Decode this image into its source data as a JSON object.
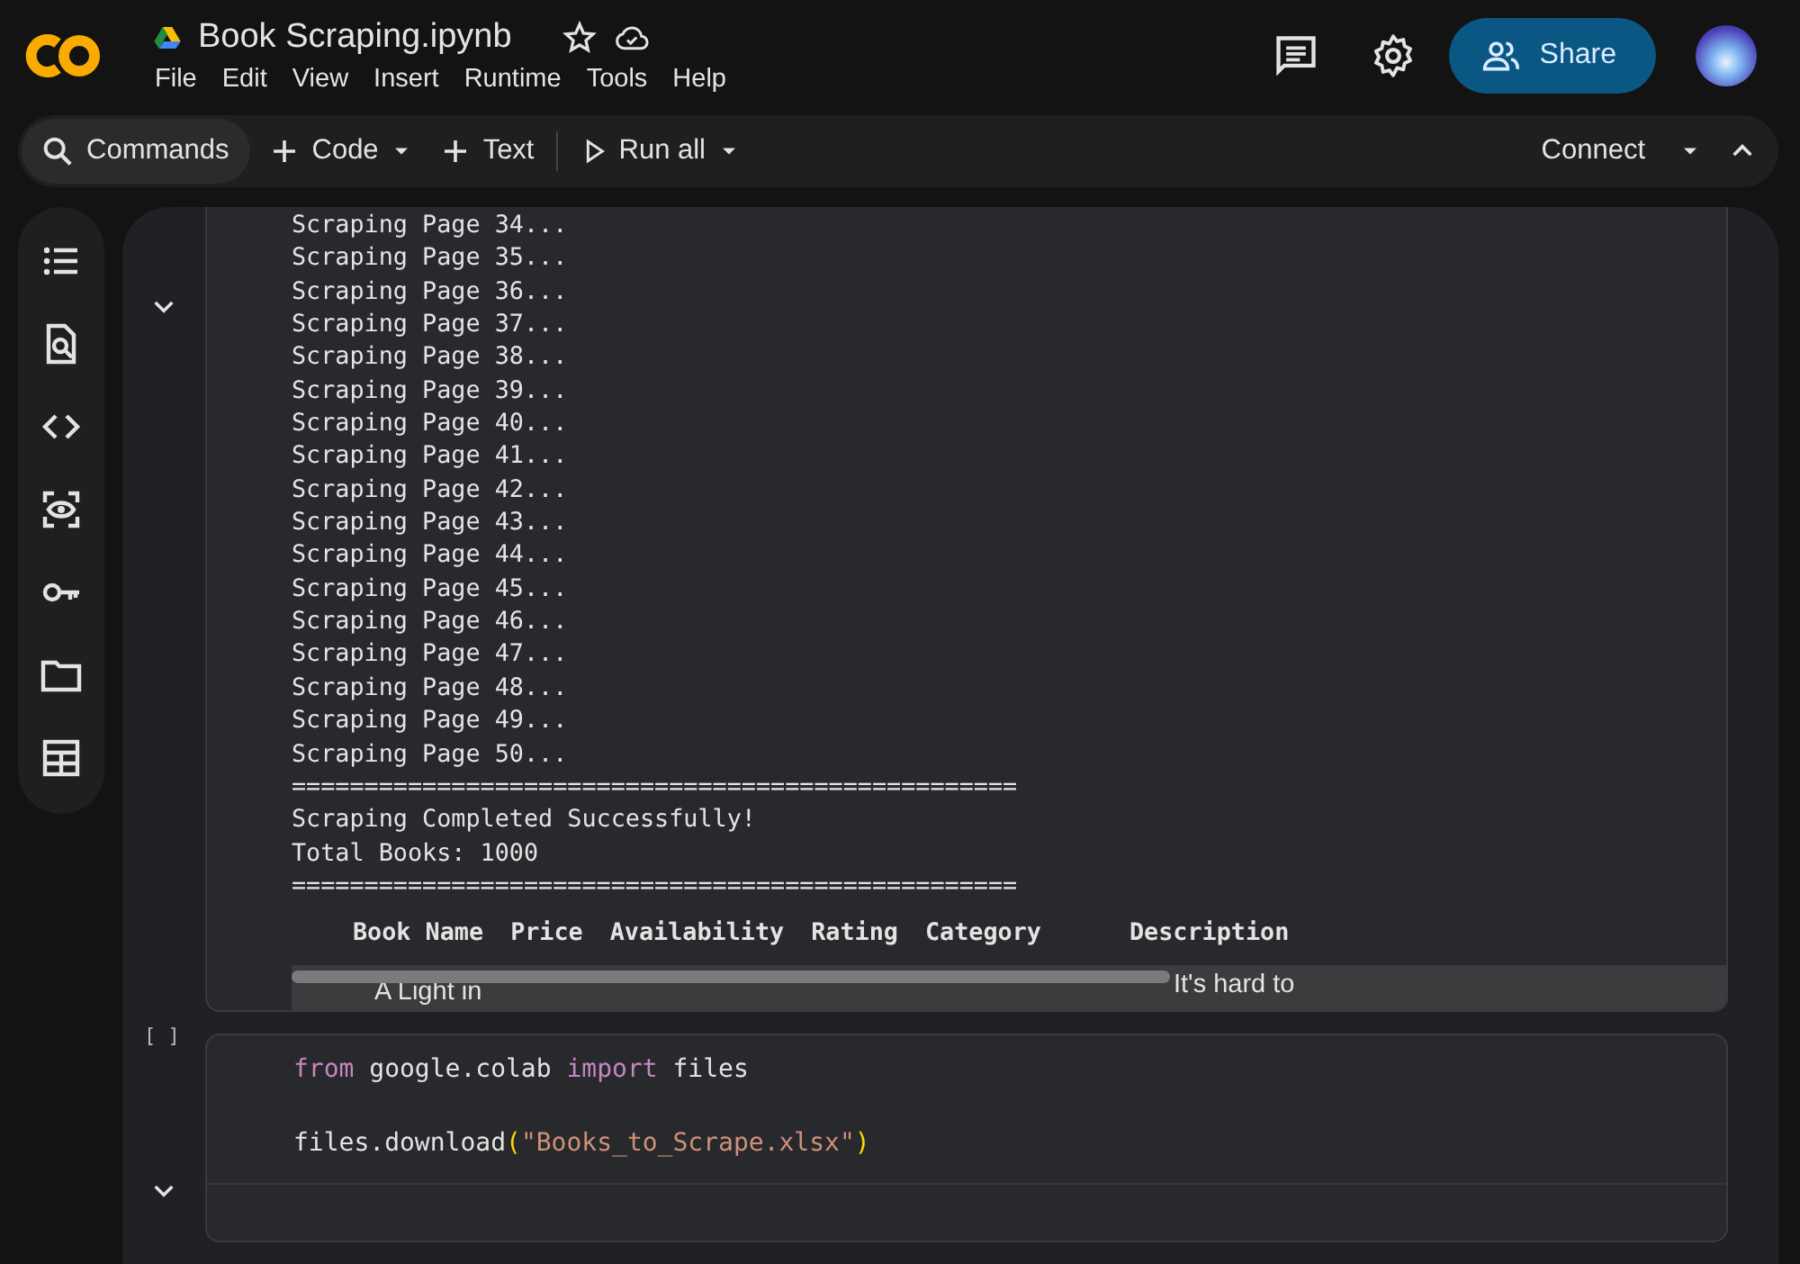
{
  "header": {
    "title": "Book Scraping.ipynb",
    "menu": [
      "File",
      "Edit",
      "View",
      "Insert",
      "Runtime",
      "Tools",
      "Help"
    ],
    "share": "Share"
  },
  "toolbar": {
    "items": [
      {
        "kind": "search",
        "label": "Commands",
        "dropdown": false
      },
      {
        "kind": "add",
        "label": "Code",
        "dropdown": true
      },
      {
        "kind": "add",
        "label": "Text",
        "dropdown": false
      },
      {
        "kind": "run",
        "label": "Run all",
        "dropdown": true
      }
    ],
    "connect": "Connect"
  },
  "output_cell": {
    "lines": [
      "Scraping Page 34...",
      "Scraping Page 35...",
      "Scraping Page 36...",
      "Scraping Page 37...",
      "Scraping Page 38...",
      "Scraping Page 39...",
      "Scraping Page 40...",
      "Scraping Page 41...",
      "Scraping Page 42...",
      "Scraping Page 43...",
      "Scraping Page 44...",
      "Scraping Page 45...",
      "Scraping Page 46...",
      "Scraping Page 47...",
      "Scraping Page 48...",
      "Scraping Page 49...",
      "Scraping Page 50...",
      "==================================================",
      "Scraping Completed Successfully!",
      "Total Books: 1000",
      "=================================================="
    ],
    "table": {
      "columns": [
        "Book Name",
        "Price",
        "Availability",
        "Rating",
        "Category",
        "Description"
      ],
      "rows": [
        {
          "book_name": "A Light in",
          "description": "It's hard to"
        }
      ]
    }
  },
  "code_cell": {
    "prompt": "[ ]",
    "lines": [
      [
        {
          "kind": "keyword",
          "text": "from"
        },
        {
          "kind": "plain",
          "text": " google.colab "
        },
        {
          "kind": "keyword",
          "text": "import"
        },
        {
          "kind": "plain",
          "text": " files"
        }
      ],
      [
        {
          "kind": "plain",
          "text": "files.download"
        },
        {
          "kind": "bracket",
          "text": "("
        },
        {
          "kind": "string",
          "text": "\"Books_to_Scrape.xlsx\""
        },
        {
          "kind": "bracket",
          "text": ")"
        }
      ]
    ]
  }
}
